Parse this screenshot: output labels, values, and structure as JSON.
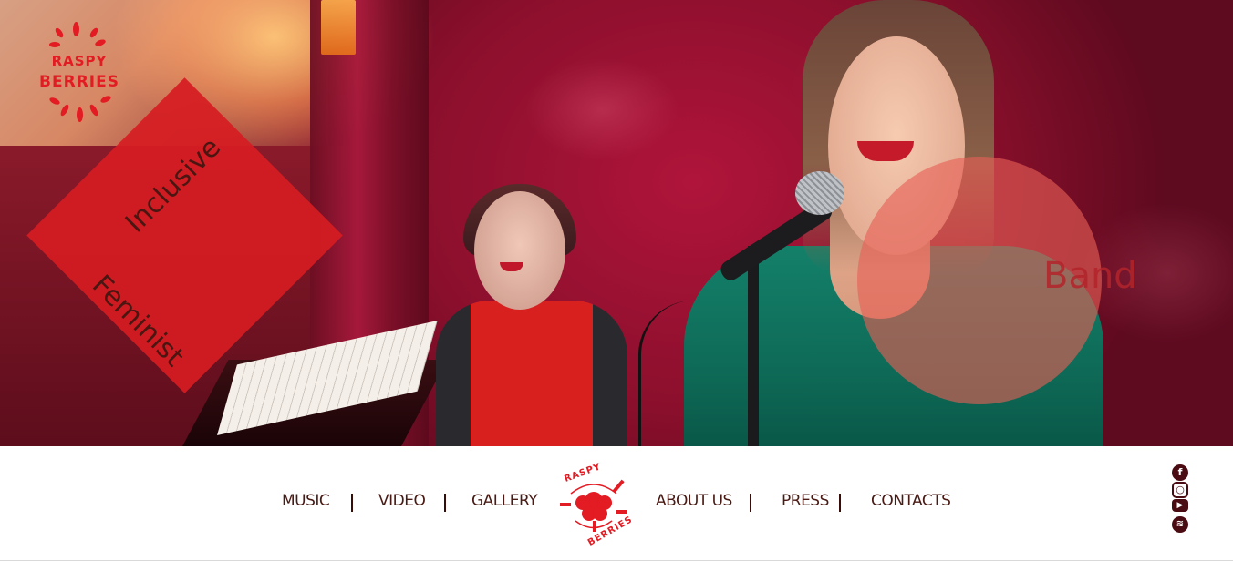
{
  "hero": {
    "logo": {
      "line1": "RASPY",
      "line2": "BERRIES"
    },
    "words": {
      "inclusive": "Inclusive",
      "feminist": "Feminist",
      "band": "Band"
    }
  },
  "nav": {
    "items": [
      "MUSIC",
      "VIDEO",
      "GALLERY",
      "ABOUT US",
      "PRESS",
      "CONTACTS"
    ],
    "center_logo": {
      "line1": "RASPY",
      "line2": "BERRIES"
    }
  },
  "social": [
    "facebook-icon",
    "instagram-icon",
    "youtube-icon",
    "spotify-icon"
  ],
  "colors": {
    "brand_red": "#e31b23",
    "nav_text": "#4a1a14",
    "separator": "#3a0c08",
    "social_icon": "#4a0c12"
  }
}
